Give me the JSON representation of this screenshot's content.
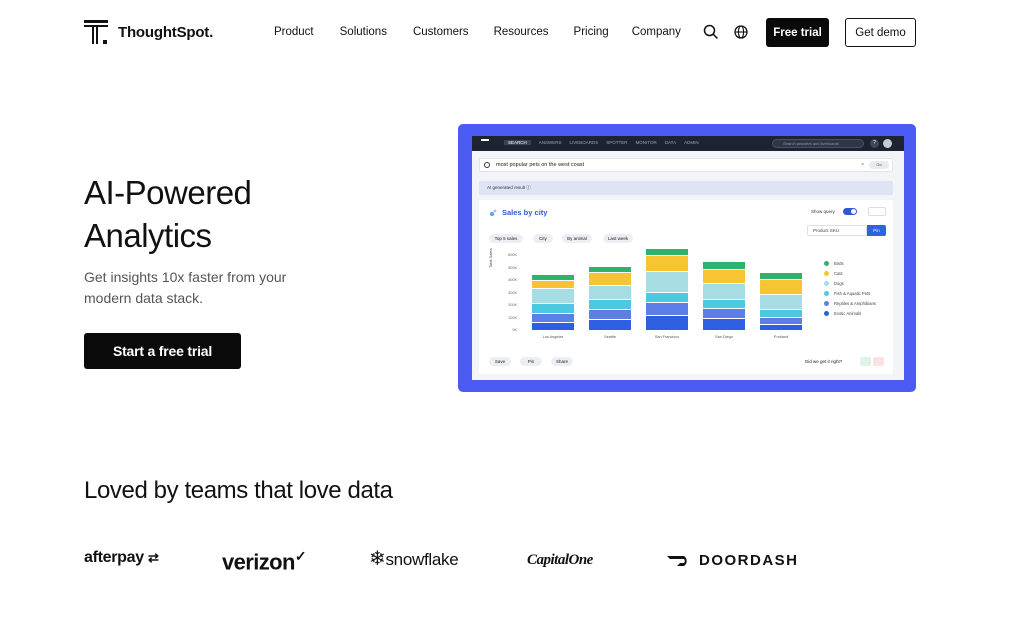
{
  "nav": {
    "brand": "ThoughtSpot.",
    "menu": [
      "Product",
      "Solutions",
      "Customers",
      "Resources",
      "Pricing",
      "Company"
    ],
    "free_trial": "Free trial",
    "get_demo": "Get demo"
  },
  "hero": {
    "title": "AI-Powered Analytics",
    "subtitle": "Get insights 10x faster from your modern data stack.",
    "cta": "Start a free trial"
  },
  "mock": {
    "tabs": [
      "SEARCH",
      "ANSWERS",
      "LIVEBOARDS",
      "SPOTTER",
      "MONITOR",
      "DATA",
      "ADMIN"
    ],
    "top_search_placeholder": "Search answers and liveboards",
    "help": "?",
    "query": "most popular pets on the west coast",
    "go": "Go",
    "ai_result": "AI generated result",
    "card_title": "Sales by city",
    "show_query": "Show query",
    "filters": [
      "Top 5 sales",
      "City",
      "By animal",
      "Last week"
    ],
    "dropdown": "Product SKU",
    "pin": "Pin",
    "y_axis_label": "Total Sales",
    "y_ticks": [
      "600K",
      "500K",
      "400K",
      "300K",
      "200K",
      "100K",
      "0K"
    ],
    "footer_buttons": [
      "Save",
      "Pin",
      "Share"
    ],
    "feedback": "Did we get it right?"
  },
  "chart_data": {
    "type": "bar",
    "stacked": true,
    "categories": [
      "Los Angeles",
      "Seattle",
      "San Francisco",
      "San Diego",
      "Portland"
    ],
    "series": [
      {
        "name": "Exotic Animals",
        "color": "#2f5fe0",
        "values": [
          68,
          90,
          120,
          95,
          50
        ]
      },
      {
        "name": "Reptiles & Amphibians",
        "color": "#5b7fe6",
        "values": [
          70,
          75,
          105,
          80,
          55
        ]
      },
      {
        "name": "Fish & Aquatic Pets",
        "color": "#4cc9e0",
        "values": [
          75,
          80,
          80,
          75,
          65
        ]
      },
      {
        "name": "Dogs",
        "color": "#a6dde4",
        "values": [
          120,
          115,
          170,
          125,
          120
        ]
      },
      {
        "name": "Cats",
        "color": "#f7c531",
        "values": [
          65,
          105,
          125,
          115,
          120
        ]
      },
      {
        "name": "Birds",
        "color": "#2fb36c",
        "values": [
          48,
          48,
          60,
          60,
          55
        ]
      }
    ],
    "ylim": [
      0,
      600
    ],
    "ylabel": "Total Sales"
  },
  "logos": {
    "heading": "Loved by teams that love data",
    "brands": [
      "afterpay",
      "verizon",
      "snowflake",
      "CapitalOne",
      "DOORDASH"
    ]
  }
}
